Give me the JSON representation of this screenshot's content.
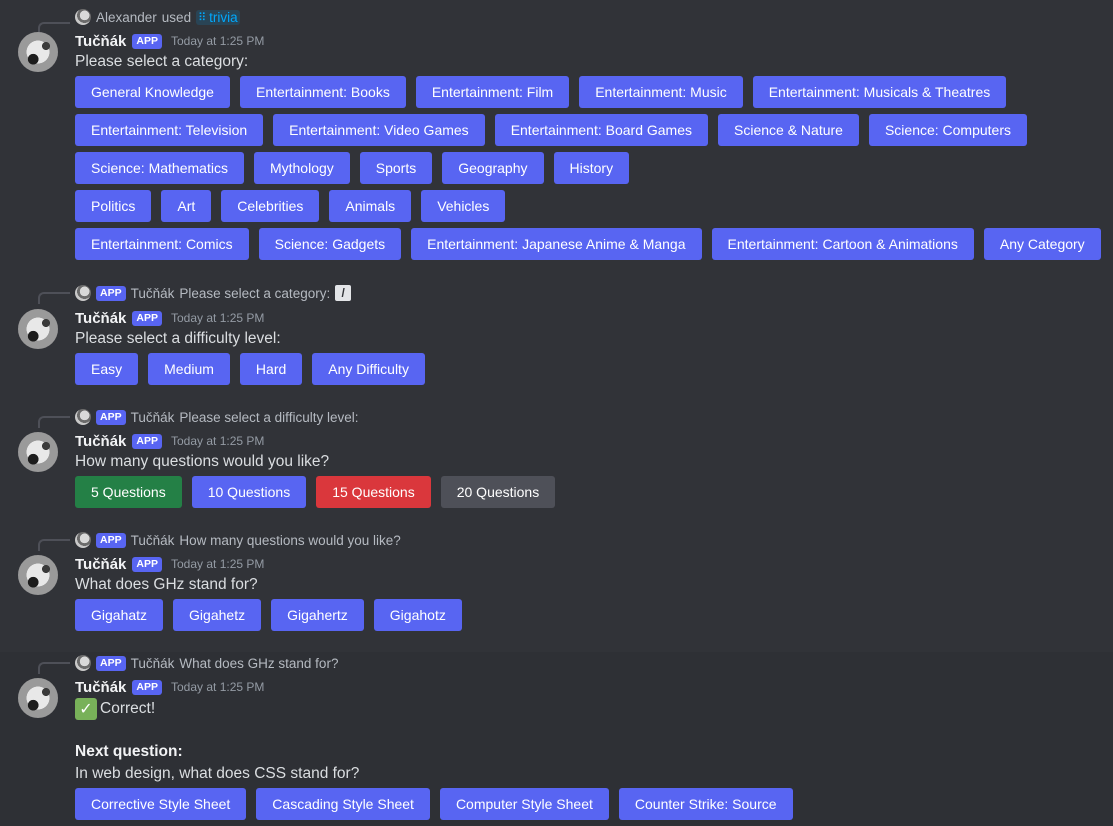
{
  "messages": [
    {
      "reply": {
        "user": "Alexander",
        "verb": "used",
        "command": "trivia"
      },
      "author": "Tučňák",
      "tag": "APP",
      "time": "Today at 1:25 PM",
      "text": "Please select a category:",
      "button_rows": [
        [
          "General Knowledge",
          "Entertainment: Books",
          "Entertainment: Film",
          "Entertainment: Music",
          "Entertainment: Musicals & Theatres"
        ],
        [
          "Entertainment: Television",
          "Entertainment: Video Games",
          "Entertainment: Board Games",
          "Science & Nature",
          "Science: Computers"
        ],
        [
          "Science: Mathematics",
          "Mythology",
          "Sports",
          "Geography",
          "History"
        ],
        [
          "Politics",
          "Art",
          "Celebrities",
          "Animals",
          "Vehicles"
        ],
        [
          "Entertainment: Comics",
          "Science: Gadgets",
          "Entertainment: Japanese Anime & Manga",
          "Entertainment: Cartoon & Animations",
          "Any Category"
        ]
      ]
    },
    {
      "reply": {
        "tag": "APP",
        "user": "Tučňák",
        "text": "Please select a category:",
        "icon": "slash-command-icon"
      },
      "author": "Tučňák",
      "tag": "APP",
      "time": "Today at 1:25 PM",
      "text": "Please select a difficulty level:",
      "buttons": [
        "Easy",
        "Medium",
        "Hard",
        "Any Difficulty"
      ]
    },
    {
      "reply": {
        "tag": "APP",
        "user": "Tučňák",
        "text": "Please select a difficulty level:"
      },
      "author": "Tučňák",
      "tag": "APP",
      "time": "Today at 1:25 PM",
      "text": "How many questions would you like?",
      "buttons": [
        "5 Questions",
        "10 Questions",
        "15 Questions",
        "20 Questions"
      ],
      "button_colors": [
        "#248046",
        "#5865f2",
        "#da373c",
        "#4e5058"
      ]
    },
    {
      "reply": {
        "tag": "APP",
        "user": "Tučňák",
        "text": "How many questions would you like?"
      },
      "author": "Tučňák",
      "tag": "APP",
      "time": "Today at 1:25 PM",
      "text": "What does GHz stand for?",
      "buttons": [
        "Gigahatz",
        "Gigahetz",
        "Gigahertz",
        "Gigahotz"
      ]
    },
    {
      "reply": {
        "tag": "APP",
        "user": "Tučňák",
        "text": "What does GHz stand for?"
      },
      "author": "Tučňák",
      "tag": "APP",
      "time": "Today at 1:25 PM",
      "status_icon": "check-mark-icon",
      "status": "Correct!",
      "next_label": "Next question:",
      "text": "In web design, what does CSS stand for?",
      "buttons": [
        "Corrective Style Sheet",
        "Cascading Style Sheet",
        "Computer Style Sheet",
        "Counter Strike: Source"
      ]
    }
  ],
  "colors": {
    "background": "#313338",
    "blurple": "#5865f2",
    "green": "#248046",
    "red": "#da373c",
    "gray": "#4e5058"
  }
}
